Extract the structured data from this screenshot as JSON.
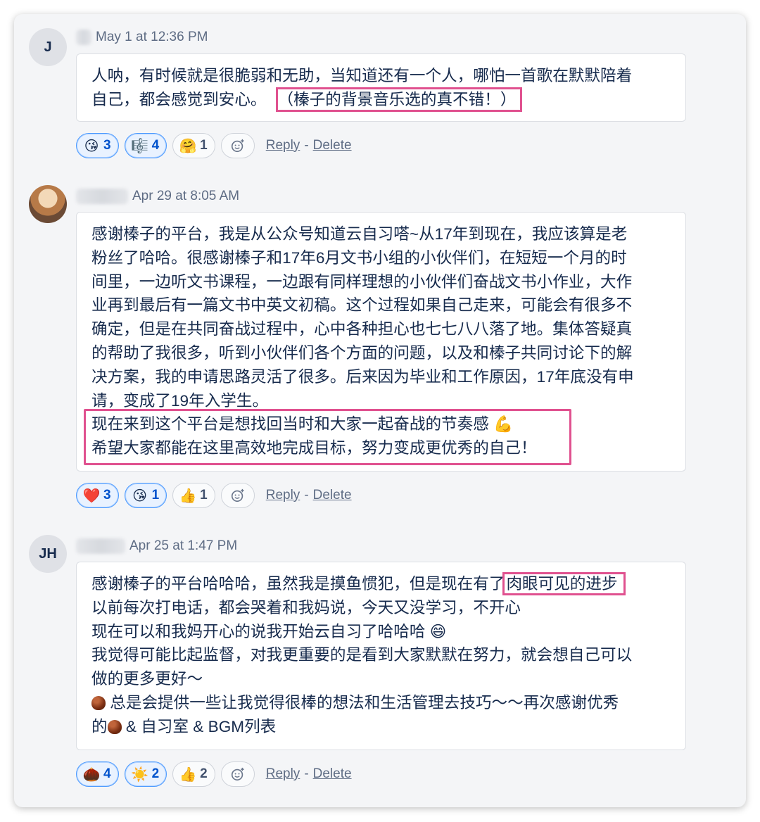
{
  "comments": [
    {
      "avatar_initials": "J",
      "timestamp": "May 1 at 12:36 PM",
      "lines": [
        "人呐，有时候就是很脆弱和无助，当知道还有一个人，哪怕一首歌在默默陪着",
        "自己，都会感觉到安心。"
      ],
      "highlight": "（榛子的背景音乐选的真不错！）",
      "reactions": [
        {
          "emoji": "kissing-face-icon",
          "glyph": "😘",
          "count": "3",
          "active": true
        },
        {
          "emoji": "musical-score-icon",
          "glyph": "🎼",
          "count": "4",
          "active": true
        },
        {
          "emoji": "hugging-face-icon",
          "glyph": "🤗",
          "count": "1",
          "active": false
        }
      ],
      "reply_label": "Reply",
      "separator": "-",
      "delete_label": "Delete"
    },
    {
      "avatar_initials": "",
      "timestamp": "Apr 29 at 8:05 AM",
      "lines": [
        "感谢榛子的平台，我是从公众号知道云自习嗒~从17年到现在，我应该算是老",
        "粉丝了哈哈。很感谢榛子和17年6月文书小组的小伙伴们，在短短一个月的时",
        "间里，一边听文书课程，一边跟有同样理想的小伙伴们奋战文书小作业，大作",
        "业再到最后有一篇文书中英文初稿。这个过程如果自己走来，可能会有很多不",
        "确定，但是在共同奋战过程中，心中各种担心也七七八八落了地。集体答疑真",
        "的帮助了我很多，听到小伙伴们各个方面的问题，以及和榛子共同讨论下的解",
        "决方案，我的申请思路灵活了很多。后来因为毕业和工作原因，17年底没有申",
        "请，变成了19年入学生。"
      ],
      "highlight_lines": [
        "现在来到这个平台是想找回当时和大家一起奋战的节奏感 💪",
        "希望大家都能在这里高效地完成目标，努力变成更优秀的自己！"
      ],
      "reactions": [
        {
          "emoji": "red-heart-icon",
          "glyph": "❤️",
          "count": "3",
          "active": true
        },
        {
          "emoji": "kissing-face-icon",
          "glyph": "😘",
          "count": "1",
          "active": true
        },
        {
          "emoji": "thumbs-up-icon",
          "glyph": "👍",
          "count": "1",
          "active": false
        }
      ],
      "reply_label": "Reply",
      "separator": "-",
      "delete_label": "Delete"
    },
    {
      "avatar_initials": "JH",
      "timestamp": "Apr 25 at 1:47 PM",
      "first_line_pre": "感谢榛子的平台哈哈哈，虽然我是摸鱼惯犯，但是现在有了",
      "first_line_hl": "肉眼可见的进步",
      "lines": [
        "以前每次打电话，都会哭着和我妈说，今天又没学习，不开心",
        "现在可以和我妈开心的说我开始云自习了哈哈哈 😄",
        "我觉得可能比起监督，对我更重要的是看到大家默默在努力，就会想自己可以",
        "做的更多更好～"
      ],
      "chestnut_line_1": " 总是会提供一些让我觉得很棒的想法和生活管理去技巧～～再次感谢优秀",
      "chestnut_line_2_pre": "的",
      "chestnut_line_2_post": " & 自习室 & BGM列表",
      "reactions": [
        {
          "emoji": "chestnut-icon",
          "glyph": "🌰",
          "count": "4",
          "active": true
        },
        {
          "emoji": "sun-icon",
          "glyph": "☀️",
          "count": "2",
          "active": true
        },
        {
          "emoji": "thumbs-up-icon",
          "glyph": "👍",
          "count": "2",
          "active": false
        }
      ],
      "reply_label": "Reply",
      "separator": "-",
      "delete_label": "Delete"
    }
  ]
}
